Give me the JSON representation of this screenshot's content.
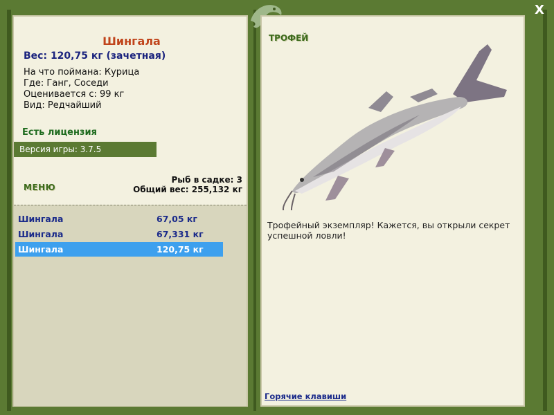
{
  "window": {
    "close_label": "X"
  },
  "fish": {
    "name": "Шингала",
    "weight_line": "Вес: 120,75 кг (зачетная)",
    "bait": "На что поймана: Курица",
    "location": "Где: Ганг, Соседи",
    "threshold": "Оценивается с: 99 кг",
    "rarity": "Вид: Редчайший"
  },
  "license_text": "Есть лицензия",
  "version_text": "Версия игры: 3.7.5",
  "menu_label": "МЕНЮ",
  "cage": {
    "count_text": "Рыб в садке: 3",
    "total_text": "Общий вес: 255,132 кг"
  },
  "catch_list": [
    {
      "name": "Шингала",
      "weight": "67,05 кг"
    },
    {
      "name": "Шингала",
      "weight": "67,331 кг"
    },
    {
      "name": "Шингала",
      "weight": "120,75 кг"
    }
  ],
  "trophy_label": "ТРОФЕЙ",
  "trophy_description": "Трофейный экземпляр! Кажется, вы открыли секрет успешной ловли!",
  "hotkeys_label": "Горячие клавиши",
  "colors": {
    "frame": "#5b7a33",
    "panel": "#f3f1e0",
    "selection": "#3da0ee"
  }
}
